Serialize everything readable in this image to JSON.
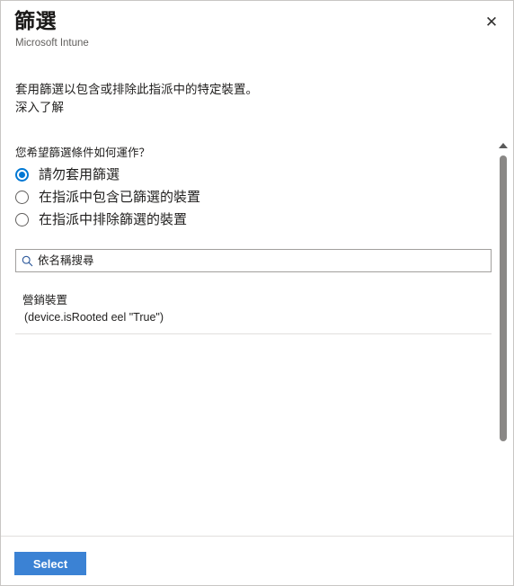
{
  "header": {
    "title": "篩選",
    "subtitle": "Microsoft Intune",
    "close_label": "✕"
  },
  "description": {
    "text": "套用篩選以包含或排除此指派中的特定裝置。",
    "learn_more": "深入了解"
  },
  "filter_mode": {
    "question": "您希望篩選條件如何運作？",
    "options": [
      {
        "label": "請勿套用篩選",
        "checked": true
      },
      {
        "label": "在指派中包含已篩選的裝置",
        "checked": false
      },
      {
        "label": "在指派中排除篩選的裝置",
        "checked": false
      }
    ]
  },
  "search": {
    "placeholder": "依名稱搜尋",
    "value": "",
    "icon": "search-icon"
  },
  "results": [
    {
      "name": "營銷裝置",
      "rule": "(device.isRooted eel \"True\")"
    }
  ],
  "footer": {
    "select_label": "Select"
  },
  "colors": {
    "accent": "#0078d4",
    "button": "#3b82d4",
    "border": "#c8c6c4",
    "divider": "#e1dfdd",
    "text": "#201f1e",
    "muted": "#605e5c"
  }
}
